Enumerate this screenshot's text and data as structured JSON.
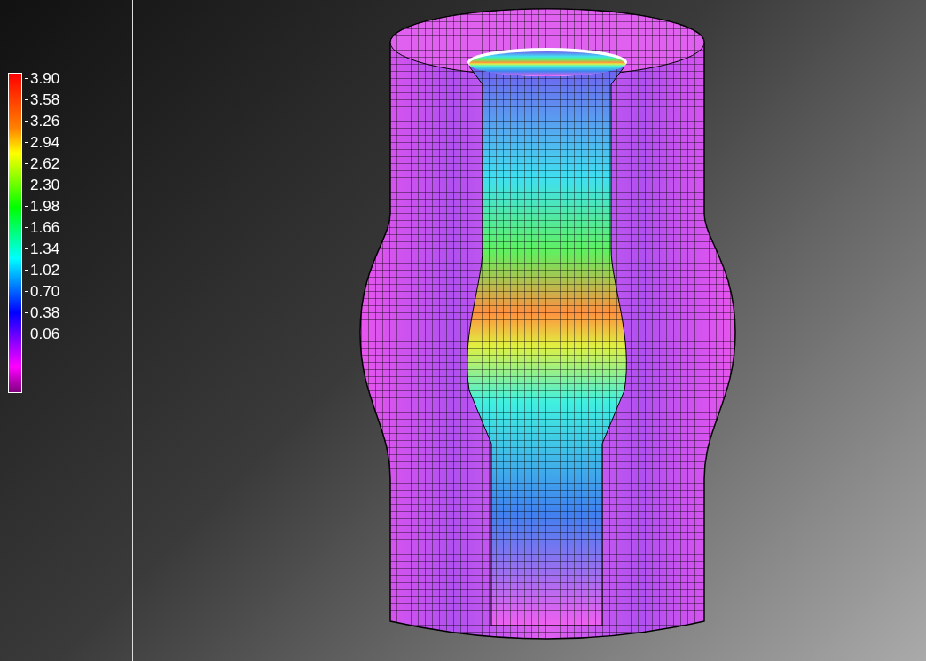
{
  "legend": {
    "labels": [
      "3.90",
      "3.58",
      "3.26",
      "2.94",
      "2.62",
      "2.30",
      "1.98",
      "1.66",
      "1.34",
      "1.02",
      "0.70",
      "0.38",
      "0.06"
    ]
  }
}
